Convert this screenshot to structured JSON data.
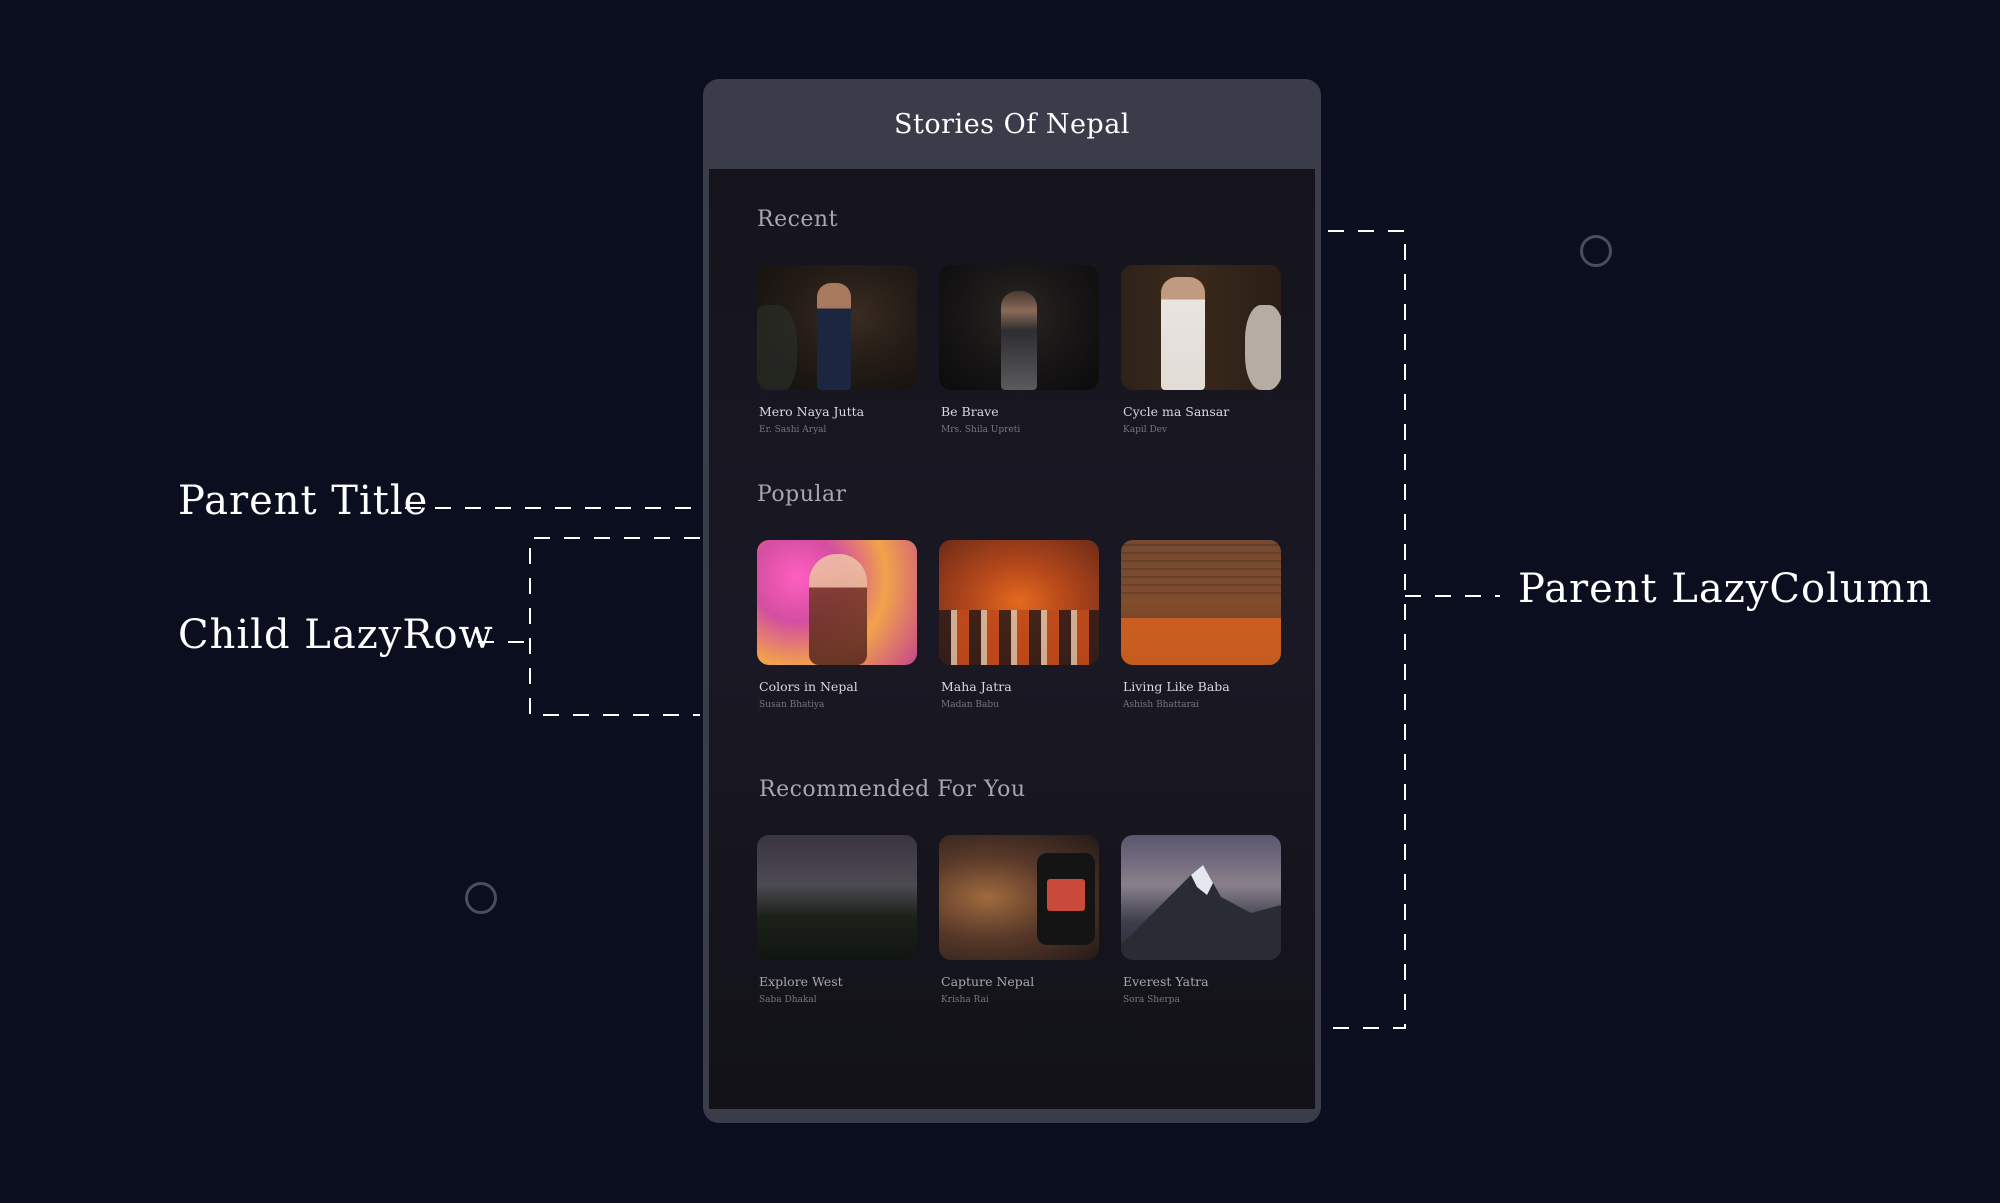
{
  "annotations": {
    "parent_title": "Parent Title",
    "child_lazyrow": "Child LazyRow",
    "parent_lazycolumn": "Parent LazyColumn"
  },
  "app": {
    "title": "Stories Of Nepal"
  },
  "sections": [
    {
      "title": "Recent",
      "items": [
        {
          "title": "Mero Naya Jutta",
          "author": "Er. Sashi Aryal"
        },
        {
          "title": "Be Brave",
          "author": "Mrs. Shila Upreti"
        },
        {
          "title": "Cycle ma Sansar",
          "author": "Kapil Dev"
        }
      ]
    },
    {
      "title": "Popular",
      "items": [
        {
          "title": "Colors in Nepal",
          "author": "Susan Bhatiya"
        },
        {
          "title": "Maha Jatra",
          "author": "Madan Babu"
        },
        {
          "title": "Living Like Baba",
          "author": "Ashish Bhattarai"
        }
      ]
    },
    {
      "title": "Recommended For You",
      "items": [
        {
          "title": "Explore West",
          "author": "Saba Dhakal"
        },
        {
          "title": "Capture Nepal",
          "author": "Krisha Rai"
        },
        {
          "title": "Everest Yatra",
          "author": "Sora Sherpa"
        }
      ]
    }
  ],
  "colors": {
    "background": "#0b0e1f",
    "appbar": "#3b3c4a",
    "screen": "#15141d",
    "guide": "#ffffff"
  }
}
